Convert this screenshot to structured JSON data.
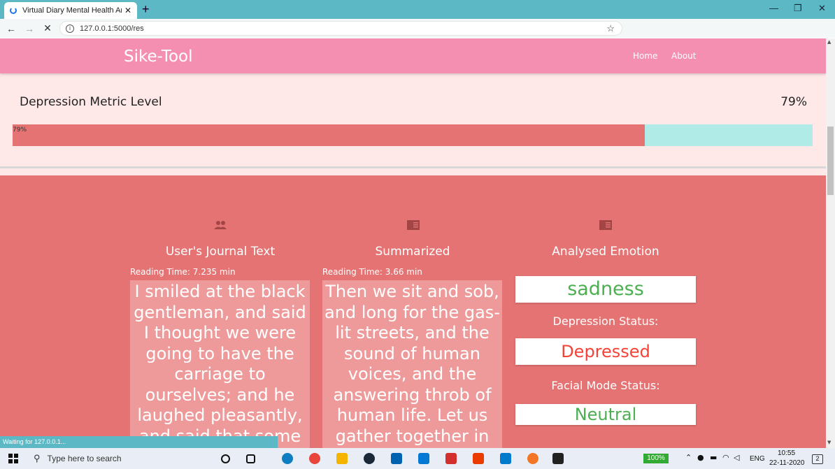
{
  "browser": {
    "tab_title": "Virtual Diary Mental Health Analy",
    "tab_close": "✕",
    "new_tab": "+",
    "url": "127.0.0.1:5000/res",
    "status": "Waiting for 127.0.0.1...",
    "window_controls": [
      "—",
      "❐",
      "✕"
    ]
  },
  "header": {
    "brand": "Sike-Tool",
    "nav": [
      "Home",
      "About"
    ]
  },
  "metric": {
    "label": "Depression Metric Level",
    "value_text": "79%",
    "bar_text": "79%",
    "percent": 79
  },
  "columns": [
    {
      "icon": "people-icon",
      "title": "User's Journal Text",
      "reading_time": "Reading Time: 7.235 min",
      "text": "I smiled at the black gentleman, and said I thought we were going to have the carriage to ourselves; and he laughed pleasantly, and said that some people"
    },
    {
      "icon": "book-icon",
      "title": "Summarized",
      "reading_time": "Reading Time: 3.66 min",
      "text": "Then we sit and sob, and long for the gas-lit streets, and the sound of human voices, and the answering throb of human life. Let us gather together in"
    },
    {
      "icon": "book-icon",
      "title": "Analysed Emotion"
    }
  ],
  "analysis": {
    "emotion": "sadness",
    "depression_label": "Depression Status:",
    "depression_value": "Depressed",
    "facial_label": "Facial Mode Status:",
    "facial_value": "Neutral"
  },
  "colors": {
    "header": "#f48fb1",
    "section": "#e57373",
    "bar_fill": "#e57373",
    "bar_track": "#b0ebe7",
    "positive": "#4caf50",
    "negative": "#f44336"
  },
  "taskbar": {
    "search_placeholder": "Type here to search",
    "battery": "100%",
    "lang": "ENG",
    "time": "10:55",
    "date": "22-11-2020",
    "notifications": "2"
  }
}
